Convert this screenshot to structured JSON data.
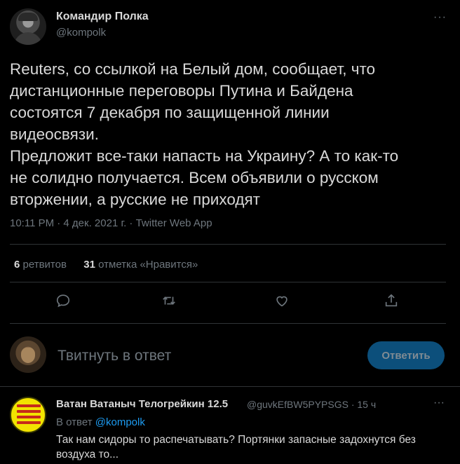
{
  "tweet": {
    "author_name": "Командир Полка",
    "author_handle": "@kompolk",
    "more": "···",
    "text_lines": [
      "Reuters, со ссылкой на Белый дом, сообщает, что",
      "дистанционные переговоры Путина и Байдена",
      "состоятся 7 декабря по защищенной линии",
      "видеосвязи.",
      "Предложит все-таки напасть на Украину? А то как-то",
      "не солидно получается. Всем объявили о русском",
      "вторжении, а русские не приходят"
    ],
    "meta": "10:11 PM · 4 дек. 2021 г. · Twitter Web App",
    "retweets_count": "6",
    "retweets_label": "ретвитов",
    "likes_count": "31",
    "likes_label": "отметка «Нравится»"
  },
  "icons": [
    "reply-icon",
    "retweet-icon",
    "like-icon",
    "share-icon"
  ],
  "compose": {
    "placeholder": "Твитнуть в ответ",
    "button_label": "Ответить"
  },
  "reply": {
    "author_name": "Ватан Ватаныч Телогрейкин 12.5",
    "handle_time": "@guvkEfBW5PYPSGS · 15 ч",
    "more": "···",
    "replying_prefix": "В ответ",
    "replying_to": "@kompolk",
    "text": "Так нам сидоры то распечатывать? Портянки запасные задохнутся без воздуха то..."
  },
  "colors": {
    "background": "#000000",
    "text": "#d9d9d9",
    "secondary": "#6e767d",
    "link": "#1d9bf0",
    "button": "#0c4f7b"
  }
}
